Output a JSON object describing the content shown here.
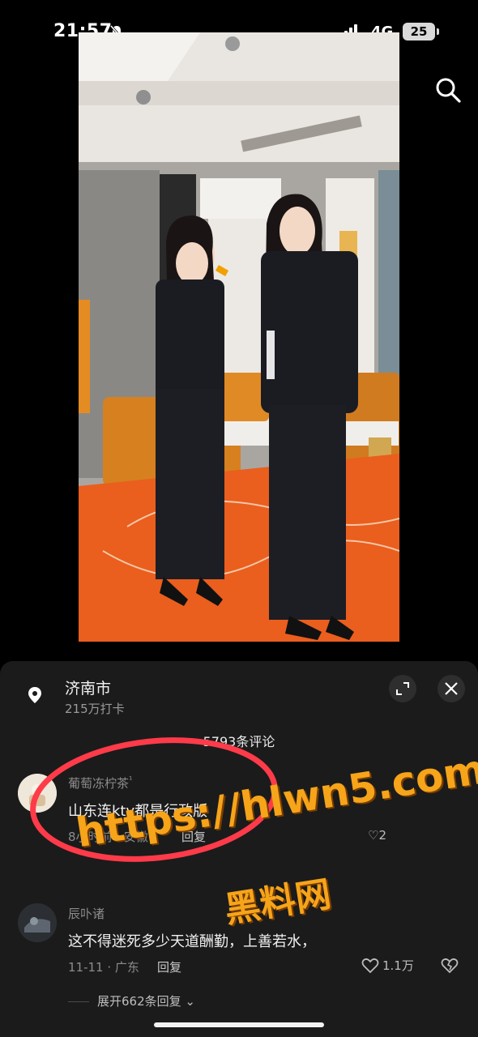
{
  "status_bar": {
    "time": "21:57",
    "network": "4G",
    "battery": "25"
  },
  "icons": {
    "search": "search-icon",
    "location": "location-pin-icon",
    "expand": "expand-icon",
    "close": "close-icon",
    "like": "heart-icon",
    "dislike": "broken-heart-icon"
  },
  "location": {
    "name": "济南市",
    "checkins": "215万打卡"
  },
  "comments_header": {
    "count": "5793条评论"
  },
  "comments": [
    {
      "user": "葡萄冻柠茶",
      "user_badge": "¹",
      "text": "山东连ktv都是行政版",
      "time_location": "8小时前 · 安徽",
      "reply": "回复",
      "likes": "2"
    },
    {
      "user": "辰卟诸",
      "text": "这不得迷死多少天道酬勤，上善若水，",
      "time_location": "11-11 · 广东",
      "reply": "回复",
      "likes": "1.1万",
      "expand": "展开662条回复"
    }
  ],
  "watermark": {
    "url": "https://hlwn5.com",
    "name": "黑料网"
  },
  "colors": {
    "sheet_bg": "#1b1b1b",
    "watermark": "#f6a41a",
    "annotation": "#ff3b4a"
  }
}
